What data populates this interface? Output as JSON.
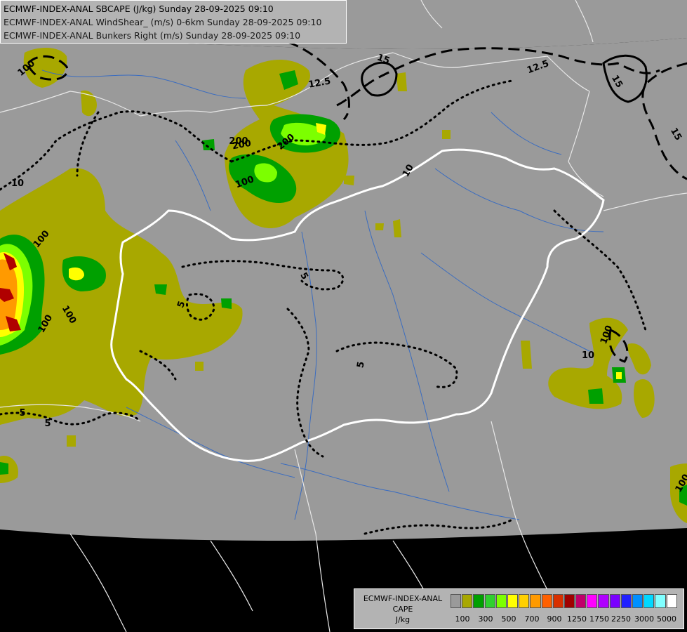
{
  "title_lines": [
    "ECMWF-INDEX-ANAL SBCAPE (J/kg) Sunday 28-09-2025 09:10",
    "ECMWF-INDEX-ANAL WindShear_ (m/s) 0-6km Sunday 28-09-2025 09:10",
    "ECMWF-INDEX-ANAL Bunkers Right (m/s) Sunday 28-09-2025 09:10"
  ],
  "legend": {
    "title_lines": [
      "ECMWF-INDEX-ANAL",
      "CAPE",
      "J/kg"
    ],
    "colors": [
      "#9a9a9a",
      "#a8a800",
      "#00a000",
      "#2fd02f",
      "#7cff00",
      "#ffff00",
      "#ffd000",
      "#ff9a00",
      "#ff6000",
      "#d83000",
      "#a00000",
      "#c0006a",
      "#ff00ff",
      "#b000ff",
      "#7a00ff",
      "#2020ff",
      "#0090ff",
      "#00d8ff",
      "#80ffff",
      "#ffffff"
    ],
    "tick_labels": [
      "100",
      "300",
      "500",
      "700",
      "900",
      "1250",
      "1750",
      "2250",
      "3000",
      "5000"
    ]
  },
  "map": {
    "field_color": "#9a9a9a",
    "background_color": "#000000",
    "cape_fill_colors": {
      "c100": "#a8a800",
      "c200": "#2fa82f",
      "c300": "#00c000",
      "c500": "#7cff00",
      "c700": "#ffff00",
      "c900": "#ff9a00",
      "c1250": "#b00000"
    },
    "contour_labels": [
      {
        "text": "100"
      },
      {
        "text": "100"
      },
      {
        "text": "200"
      },
      {
        "text": "200"
      },
      {
        "text": "100"
      },
      {
        "text": "200"
      },
      {
        "text": "100"
      },
      {
        "text": "100"
      },
      {
        "text": "100"
      },
      {
        "text": "100"
      },
      {
        "text": "10"
      },
      {
        "text": "10"
      },
      {
        "text": "10"
      },
      {
        "text": "5"
      },
      {
        "text": "5"
      },
      {
        "text": "5"
      },
      {
        "text": "5"
      },
      {
        "text": "5"
      },
      {
        "text": "12.5"
      },
      {
        "text": "12.5"
      },
      {
        "text": "15"
      },
      {
        "text": "15"
      },
      {
        "text": "15"
      }
    ]
  }
}
